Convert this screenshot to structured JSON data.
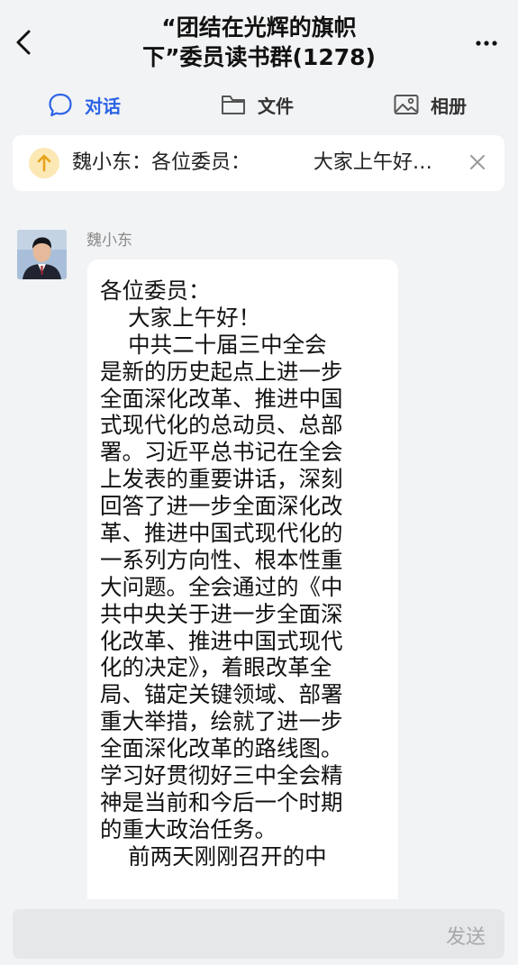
{
  "header": {
    "title_line1": "“团结在光辉的旗帜",
    "title_line2": "下”委员读书群(1278)"
  },
  "tabs": [
    {
      "label": "对话",
      "icon": "chat-bubble-icon",
      "active": true
    },
    {
      "label": "文件",
      "icon": "folder-icon",
      "active": false
    },
    {
      "label": "相册",
      "icon": "image-icon",
      "active": false
    }
  ],
  "pinned": {
    "text": "魏小东：各位委员：          大家上午好…"
  },
  "message": {
    "sender": "魏小东",
    "lines": [
      "各位委员：",
      "    大家上午好！",
      "    中共二十届三中全会",
      "是新的历史起点上进一步",
      "全面深化改革、推进中国",
      "式现代化的总动员、总部",
      "署。习近平总书记在全会",
      "上发表的重要讲话，深刻",
      "回答了进一步全面深化改",
      "革、推进中国式现代化的",
      "一系列方向性、根本性重",
      "大问题。全会通过的《中",
      "共中央关于进一步全面深",
      "化改革、推进中国式现代",
      "化的决定》，着眼改革全",
      "局、锚定关键领域、部署",
      "重大举措，绘就了进一步",
      "全面深化改革的路线图。",
      "学习好贯彻好三中全会精",
      "神是当前和今后一个时期",
      "的重大政治任务。",
      "    前两天刚刚召开的中"
    ]
  },
  "input": {
    "send_label": "发送"
  },
  "colors": {
    "accent": "#2b63e6",
    "background": "#f2f3f5",
    "pin_icon_bg": "#fbe8b4",
    "pin_arrow": "#e8a21c"
  }
}
